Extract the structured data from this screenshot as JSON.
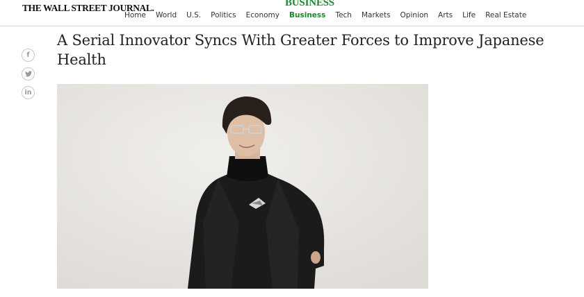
{
  "header": {
    "logo_text": "THE WALL STREET JOURNAL.",
    "section_name": "BUSINESS"
  },
  "nav": {
    "items": [
      {
        "label": "Home"
      },
      {
        "label": "World"
      },
      {
        "label": "U.S."
      },
      {
        "label": "Politics"
      },
      {
        "label": "Economy"
      },
      {
        "label": "Business",
        "active": true
      },
      {
        "label": "Tech"
      },
      {
        "label": "Markets"
      },
      {
        "label": "Opinion"
      },
      {
        "label": "Arts"
      },
      {
        "label": "Life"
      },
      {
        "label": "Real Estate"
      }
    ]
  },
  "share": {
    "facebook": "f",
    "twitter": "twitter-bird",
    "linkedin": "in"
  },
  "article": {
    "headline": "A Serial Innovator Syncs With Greater Forces to Improve Japanese Health"
  },
  "colors": {
    "accent_green": "#1a8a2c",
    "photo_backdrop": "#ece9e5",
    "jacket": "#1a1a1a"
  }
}
